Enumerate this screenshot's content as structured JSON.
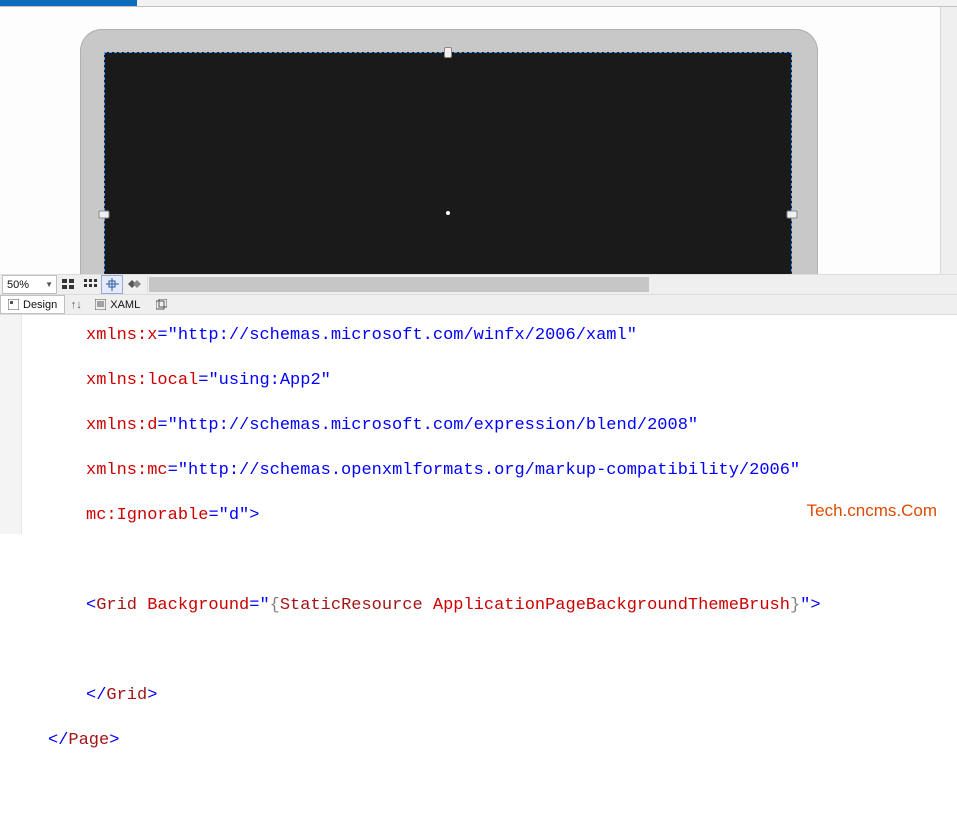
{
  "zoom": {
    "value": "50%"
  },
  "split": {
    "design_label": "Design",
    "xaml_label": "XAML"
  },
  "code": {
    "l1a": "xmlns",
    "l1b": ":",
    "l1c": "x",
    "l1d": "=",
    "l1e": "\"http://schemas.microsoft.com/winfx/2006/xaml\"",
    "l2a": "xmlns",
    "l2b": ":",
    "l2c": "local",
    "l2d": "=",
    "l2e": "\"using:App2\"",
    "l3a": "xmlns",
    "l3b": ":",
    "l3c": "d",
    "l3d": "=",
    "l3e": "\"http://schemas.microsoft.com/expression/blend/2008\"",
    "l4a": "xmlns",
    "l4b": ":",
    "l4c": "mc",
    "l4d": "=",
    "l4e": "\"http://schemas.openxmlformats.org/markup-compatibility/2006\"",
    "l5a": "mc",
    "l5b": ":",
    "l5c": "Ignorable",
    "l5d": "=",
    "l5e": "\"d\"",
    "l5f": ">",
    "l7a": "<",
    "l7b": "Grid",
    "l7c": " ",
    "l7d": "Background",
    "l7e": "=",
    "l7f": "\"",
    "l7g": "{",
    "l7h": "StaticResource",
    "l7i": " ",
    "l7j": "ApplicationPageBackgroundThemeBrush",
    "l7k": "}",
    "l7l": "\"",
    "l7m": ">",
    "l9a": "</",
    "l9b": "Grid",
    "l9c": ">",
    "l10a": "</",
    "l10b": "Page",
    "l10c": ">"
  },
  "watermark": "Tech.cncms.Com"
}
